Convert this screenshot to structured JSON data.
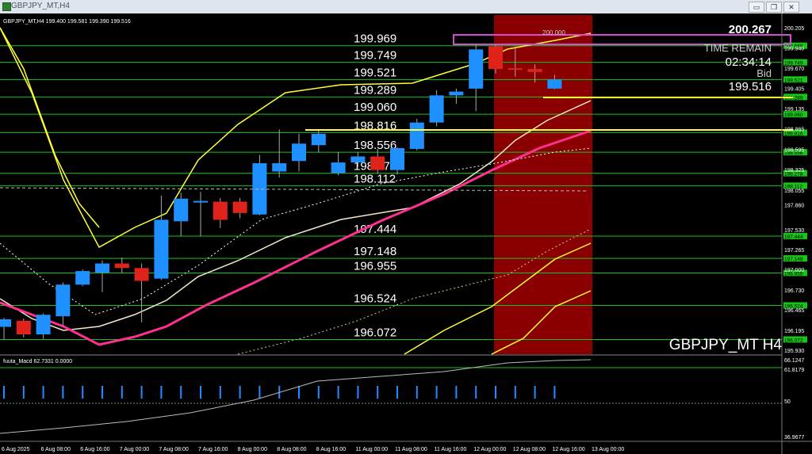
{
  "window": {
    "title": "GBPJPY_MT,H4",
    "minimize_glyph": "▭",
    "restore_glyph": "❐",
    "close_glyph": "✕"
  },
  "chart": {
    "info_line": "GBPJPY_MT,H4  199.400 199.581 199.390 199.516",
    "watermark": "GBPJPY_MT H4",
    "top_price": "200.267",
    "time_remain_label": "TIME REMAIN",
    "time_remain_value": "02:34:14",
    "bid_label": "Bid",
    "bid_value": "199.516",
    "box_label": "200.000",
    "macd_label": "fuuta_Macd 62.7331  0.0000",
    "colors": {
      "background": "#000000",
      "bull": "#1e90ff",
      "bear": "#e0231a",
      "level": "#18c418",
      "yellow": "#ffff33",
      "pink": "#ff2f8f",
      "session": "#8a0000",
      "magenta": "#d44bd4"
    }
  },
  "chart_data": {
    "type": "candlestick",
    "symbol": "GBPJPY_MT",
    "timeframe": "H4",
    "candles": [
      {
        "o": 196.24,
        "h": 196.36,
        "l": 196.07,
        "c": 196.34
      },
      {
        "o": 196.32,
        "h": 196.35,
        "l": 196.1,
        "c": 196.14
      },
      {
        "o": 196.14,
        "h": 196.42,
        "l": 196.08,
        "c": 196.4
      },
      {
        "o": 196.38,
        "h": 196.83,
        "l": 196.25,
        "c": 196.8
      },
      {
        "o": 196.8,
        "h": 197.0,
        "l": 196.78,
        "c": 196.98
      },
      {
        "o": 196.96,
        "h": 197.12,
        "l": 196.7,
        "c": 197.08
      },
      {
        "o": 197.08,
        "h": 197.16,
        "l": 196.95,
        "c": 197.02
      },
      {
        "o": 197.02,
        "h": 197.08,
        "l": 196.3,
        "c": 196.85
      },
      {
        "o": 196.88,
        "h": 197.98,
        "l": 196.86,
        "c": 197.66
      },
      {
        "o": 197.64,
        "h": 198.02,
        "l": 197.44,
        "c": 197.94
      },
      {
        "o": 197.91,
        "h": 198.03,
        "l": 197.44,
        "c": 197.91
      },
      {
        "o": 197.9,
        "h": 197.95,
        "l": 197.55,
        "c": 197.66
      },
      {
        "o": 197.9,
        "h": 197.95,
        "l": 197.68,
        "c": 197.75
      },
      {
        "o": 197.73,
        "h": 198.52,
        "l": 197.72,
        "c": 198.41
      },
      {
        "o": 198.3,
        "h": 198.86,
        "l": 198.22,
        "c": 198.41
      },
      {
        "o": 198.44,
        "h": 198.8,
        "l": 198.3,
        "c": 198.67
      },
      {
        "o": 198.65,
        "h": 198.86,
        "l": 198.55,
        "c": 198.8
      },
      {
        "o": 198.28,
        "h": 198.56,
        "l": 198.25,
        "c": 198.42
      },
      {
        "o": 198.42,
        "h": 198.56,
        "l": 198.36,
        "c": 198.5
      },
      {
        "o": 198.5,
        "h": 198.6,
        "l": 198.27,
        "c": 198.32
      },
      {
        "o": 198.32,
        "h": 198.62,
        "l": 198.26,
        "c": 198.61
      },
      {
        "o": 198.6,
        "h": 199.0,
        "l": 198.58,
        "c": 198.95
      },
      {
        "o": 198.95,
        "h": 199.38,
        "l": 198.9,
        "c": 199.31
      },
      {
        "o": 199.31,
        "h": 199.4,
        "l": 199.2,
        "c": 199.36
      },
      {
        "o": 199.4,
        "h": 200.0,
        "l": 199.1,
        "c": 199.92
      },
      {
        "o": 199.96,
        "h": 199.98,
        "l": 199.6,
        "c": 199.66
      },
      {
        "o": 199.67,
        "h": 199.96,
        "l": 199.56,
        "c": 199.66
      },
      {
        "o": 199.66,
        "h": 199.72,
        "l": 199.48,
        "c": 199.62
      },
      {
        "o": 199.4,
        "h": 199.58,
        "l": 199.39,
        "c": 199.52
      }
    ],
    "levels": [
      "199.969",
      "199.749",
      "199.521",
      "199.289",
      "199.060",
      "198.816",
      "198.556",
      "198.278",
      "198.112",
      "197.444",
      "197.148",
      "196.955",
      "196.524",
      "196.072"
    ],
    "level_values": [
      199.969,
      199.749,
      199.521,
      199.289,
      199.06,
      198.816,
      198.556,
      198.278,
      198.112,
      197.444,
      197.148,
      196.955,
      196.524,
      196.072
    ],
    "axis_labels": [
      "200.205",
      "199.940",
      "199.670",
      "199.405",
      "199.135",
      "198.865",
      "198.595",
      "198.325",
      "198.055",
      "197.860",
      "197.530",
      "197.265",
      "197.000",
      "196.730",
      "196.465",
      "196.195",
      "195.930"
    ],
    "axis_values": [
      200.205,
      199.94,
      199.67,
      199.405,
      199.135,
      198.865,
      198.595,
      198.325,
      198.055,
      197.86,
      197.53,
      197.265,
      197.0,
      196.73,
      196.465,
      196.195,
      195.93
    ],
    "time_labels": [
      "6 Aug 2025",
      "6 Aug 08:00",
      "6 Aug 16:00",
      "7 Aug 00:00",
      "7 Aug 08:00",
      "7 Aug 16:00",
      "8 Aug 00:00",
      "8 Aug 08:00",
      "8 Aug 16:00",
      "11 Aug 00:00",
      "11 Aug 08:00",
      "11 Aug 16:00",
      "12 Aug 00:00",
      "12 Aug 08:00",
      "12 Aug 16:00",
      "13 Aug 00:00"
    ],
    "price_range": [
      195.93,
      200.26
    ],
    "macd_axis_labels": [
      "66.1247",
      "61.8179",
      "50",
      "36.9677"
    ]
  }
}
